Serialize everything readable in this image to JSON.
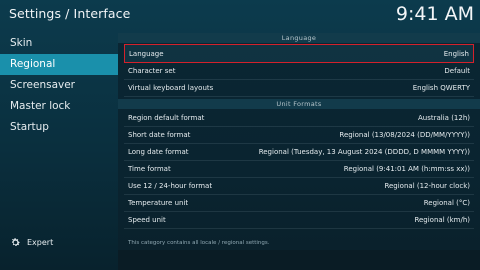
{
  "header": {
    "title": "Settings / Interface",
    "clock": "9:41 AM"
  },
  "nav": {
    "items": [
      {
        "label": "Skin"
      },
      {
        "label": "Regional"
      },
      {
        "label": "Screensaver"
      },
      {
        "label": "Master lock"
      },
      {
        "label": "Startup"
      }
    ],
    "active_index": 1,
    "expert_label": "Expert"
  },
  "language_section": {
    "header": "Language",
    "rows": [
      {
        "label": "Language",
        "value": "English"
      },
      {
        "label": "Character set",
        "value": "Default"
      },
      {
        "label": "Virtual keyboard layouts",
        "value": "English QWERTY"
      }
    ]
  },
  "units_section": {
    "header": "Unit Formats",
    "rows": [
      {
        "label": "Region default format",
        "value": "Australia (12h)"
      },
      {
        "label": "Short date format",
        "value": "Regional (13/08/2024 (DD/MM/YYYY))"
      },
      {
        "label": "Long date format",
        "value": "Regional (Tuesday, 13 August 2024 (DDDD, D MMMM YYYY))"
      },
      {
        "label": "Time format",
        "value": "Regional (9:41:01 AM (h:mm:ss xx))"
      },
      {
        "label": "Use 12 / 24-hour format",
        "value": "Regional (12-hour clock)"
      },
      {
        "label": "Temperature unit",
        "value": "Regional (°C)"
      },
      {
        "label": "Speed unit",
        "value": "Regional (km/h)"
      }
    ]
  },
  "hint": "This category contains all locale / regional settings.",
  "colors": {
    "accent": "#1a90ab",
    "focus_border": "#d4212b"
  }
}
